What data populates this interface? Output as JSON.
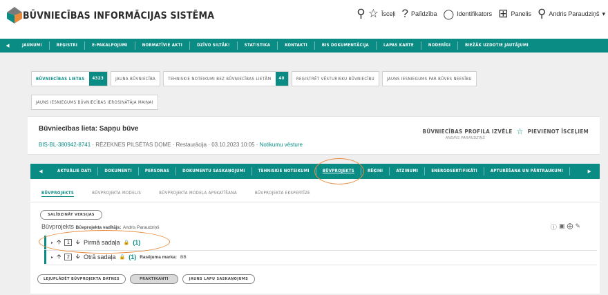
{
  "app": {
    "title": "BŪVNIECĪBAS INFORMĀCIJAS SISTĒMA"
  },
  "topbar": {
    "favorites": "Īsceļi",
    "help": "Palīdzība",
    "identifiers": "Identifikators",
    "panel": "Panelis",
    "user": "Andris Paraudziņš",
    "icons": [
      "search-icon",
      "star-icon",
      "question-icon",
      "chat-icon",
      "grid-icon",
      "user-icon",
      "caret-down-icon"
    ]
  },
  "mainnav": {
    "items": [
      "JAUNUMI",
      "REĢISTRI",
      "E-PAKALPOJUMI",
      "NORMATĪVIE AKTI",
      "DZĪVO SILTĀK!",
      "STATISTIKA",
      "KONTAKTI",
      "BIS DOKUMENTĀCIJA",
      "LAPAS KARTE",
      "NODERĪGI",
      "BIEŽĀK UZDOTIE JAUTĀJUMI"
    ]
  },
  "tabs": {
    "row1": [
      {
        "label": "BŪVNIECĪBAS LIETAS",
        "badge": "4323",
        "active": true
      },
      {
        "label": "JAUNA BŪVNIECĪBA"
      },
      {
        "label": "TEHNISKIE NOTEIKUMI BEZ BŪVNIECĪBAS LIETĀM",
        "badge": "40"
      },
      {
        "label": "REĢISTRĒT VĒSTURISKU BŪVNIECĪBU"
      },
      {
        "label": "JAUNS IESNIEGUMS PAR BŪVES NEESĪBU"
      }
    ],
    "row2": [
      {
        "label": "JAUNS IESNIEGUMS BŪVNIECĪBAS IEROSINĀTĀJA MAIŅAI"
      }
    ]
  },
  "case": {
    "title": "Būvniecības lieta: Sapņu būve",
    "id": "BIS-BL-380942-8741",
    "authority": "RĒZEKNES PILSĒTAS DOME",
    "type": "Restaurācija",
    "date": "03.10.2023 10:05",
    "history_link": "Notikumu vēsture",
    "profile_label": "BŪVNIECĪBAS PROFILA IZVĒLE",
    "profile_user": "ANDRIS PARAUDZIŅŠ",
    "favorite_label": "PIEVIENOT ĪSCEĻIEM"
  },
  "subnav": {
    "items": [
      "AKTUĀLIE DATI",
      "DOKUMENTI",
      "PERSONAS",
      "DOKUMENTU SASKAŅOJUMI",
      "TEHNISKIE NOTEIKUMI",
      "BŪVPROJEKTS",
      "RĒĶINI",
      "ATZINUMI",
      "ENERGOSERTIFIKĀTI",
      "APTURĒŠANA UN PĀRTRAUKUMI"
    ],
    "active": "BŪVPROJEKTS"
  },
  "subtabs": {
    "items": [
      "BŪVPROJEKTS",
      "BŪVPROJEKTA MODELIS",
      "BŪVPROJEKTA MODEĻA APSKATĪŠANA",
      "BŪVPROJEKTA EKSPERTĪZE"
    ],
    "active": "BŪVPROJEKTS"
  },
  "project": {
    "compare_button": "SALĪDZINĀT VERSIJAS",
    "label": "Būvprojekts",
    "leader_label": "Būvprojekta vadītājs:",
    "leader_name": "Andris Paraudziņš",
    "sections": [
      {
        "num": "1",
        "name": "Pirmā sadaļa",
        "count": "(1)"
      },
      {
        "num": "2",
        "name": "Otrā sadaļa",
        "count": "(1)",
        "tag_label": "Rasējuma marka:",
        "tag_value": "BB"
      }
    ],
    "buttons": [
      "LEJUPLĀDĒT BŪVPROJEKTA DATNES",
      "PRAKTIKANTI",
      "JAUNS LAPU SASKAŅOJUMS"
    ]
  },
  "colors": {
    "accent": "#0a8c84",
    "highlight": "#e98a3a",
    "background": "#efefef"
  }
}
